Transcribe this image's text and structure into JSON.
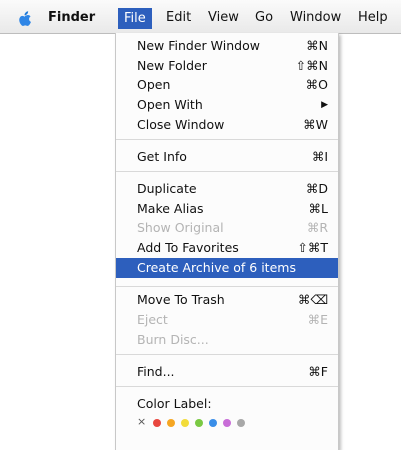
{
  "menubar": {
    "items": [
      {
        "label": "Finder"
      },
      {
        "label": "File"
      },
      {
        "label": "Edit"
      },
      {
        "label": "View"
      },
      {
        "label": "Go"
      },
      {
        "label": "Window"
      },
      {
        "label": "Help"
      }
    ]
  },
  "file_menu": {
    "items": [
      {
        "label": "New Finder Window",
        "shortcut": "⌘N"
      },
      {
        "label": "New Folder",
        "shortcut": "⇧⌘N"
      },
      {
        "label": "Open",
        "shortcut": "⌘O"
      },
      {
        "label": "Open With",
        "shortcut": "▶"
      },
      {
        "label": "Close Window",
        "shortcut": "⌘W"
      },
      {
        "label": "Get Info",
        "shortcut": "⌘I"
      },
      {
        "label": "Duplicate",
        "shortcut": "⌘D"
      },
      {
        "label": "Make Alias",
        "shortcut": "⌘L"
      },
      {
        "label": "Show Original",
        "shortcut": "⌘R"
      },
      {
        "label": "Add To Favorites",
        "shortcut": "⇧⌘T"
      },
      {
        "label": "Create Archive of 6 items",
        "shortcut": ""
      },
      {
        "label": "Move To Trash",
        "shortcut": "⌘⌫"
      },
      {
        "label": "Eject",
        "shortcut": "⌘E"
      },
      {
        "label": "Burn Disc...",
        "shortcut": ""
      },
      {
        "label": "Find...",
        "shortcut": "⌘F"
      },
      {
        "label": "Color Label:",
        "shortcut": ""
      }
    ],
    "color_labels": {
      "remove_symbol": "×",
      "colors": [
        "#e8473f",
        "#f5a623",
        "#f2dc3a",
        "#7ac943",
        "#3a8ee8",
        "#c86dd7",
        "#a8a8a8"
      ]
    }
  },
  "theme": {
    "highlight": "#2d5fbd"
  }
}
